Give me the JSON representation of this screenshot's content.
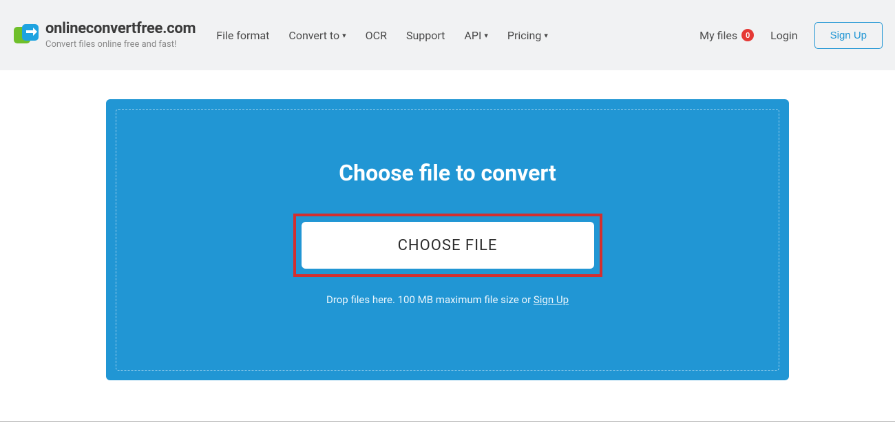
{
  "header": {
    "site_name": "onlineconvertfree.com",
    "tagline": "Convert files online free and fast!",
    "nav": {
      "file_format": "File format",
      "convert_to": "Convert to",
      "ocr": "OCR",
      "support": "Support",
      "api": "API",
      "pricing": "Pricing"
    },
    "my_files_label": "My files",
    "my_files_count": "0",
    "login": "Login",
    "signup": "Sign Up"
  },
  "dropzone": {
    "title": "Choose file to convert",
    "choose_button": "CHOOSE FILE",
    "hint_prefix": "Drop files here. 100 MB maximum file size or ",
    "hint_link": "Sign Up"
  },
  "colors": {
    "accent": "#2196d4",
    "highlight_border": "#d32f2f",
    "badge": "#e53935"
  }
}
